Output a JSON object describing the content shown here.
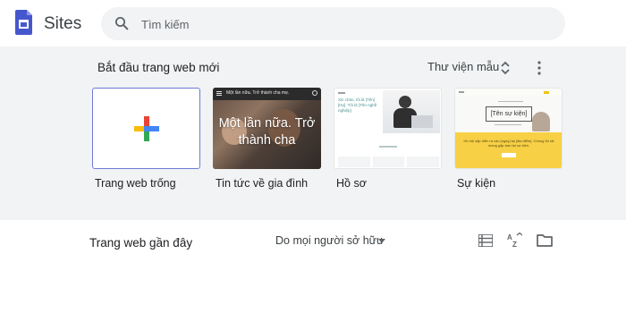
{
  "app": {
    "name": "Sites"
  },
  "search": {
    "placeholder": "Tìm kiếm"
  },
  "templates": {
    "title": "Bắt đầu trang web mới",
    "gallery_label": "Thư viện mẫu",
    "cards": [
      {
        "label": "Trang web trống"
      },
      {
        "label": "Tin tức về gia đình",
        "preview_bar": "Một lần nữa. Trở thành cha mẹ.",
        "preview_hero": "Một lần nữa. Trở thành cha"
      },
      {
        "label": "Hồ sơ",
        "preview_heading": "Xin chào, tôi là [Tên] [Họ]. Tôi là [Tên nghề nghiệp]"
      },
      {
        "label": "Sự kiện",
        "preview_title": "[Tên sự kiện]",
        "preview_text": "Hồ hội sắp diễn ra vào [ngày] tại [địa điểm]. Chúng tôi rất mong gặp bạn tại sự kiện."
      }
    ]
  },
  "recent": {
    "title": "Trang web gần đây",
    "owner_filter": "Do mọi người sở hữu"
  },
  "icons": {
    "logo": "google-sites-logo",
    "search": "search-icon",
    "unfold": "unfold-more-icon",
    "more": "more-vert-icon",
    "plus": "google-plus-icon",
    "dropdown": "arrow-drop-down-icon",
    "list": "list-view-icon",
    "sort": "sort-az-icon",
    "folder": "folder-icon"
  },
  "colors": {
    "brand": "#4657ce",
    "panel_bg": "#f1f3f4",
    "blank_card_border": "#6f7bd8",
    "event_yellow": "#f7d046",
    "plus_blue": "#4285f4",
    "plus_red": "#ea4335",
    "plus_yellow": "#fbbc04",
    "plus_green": "#34a853"
  }
}
